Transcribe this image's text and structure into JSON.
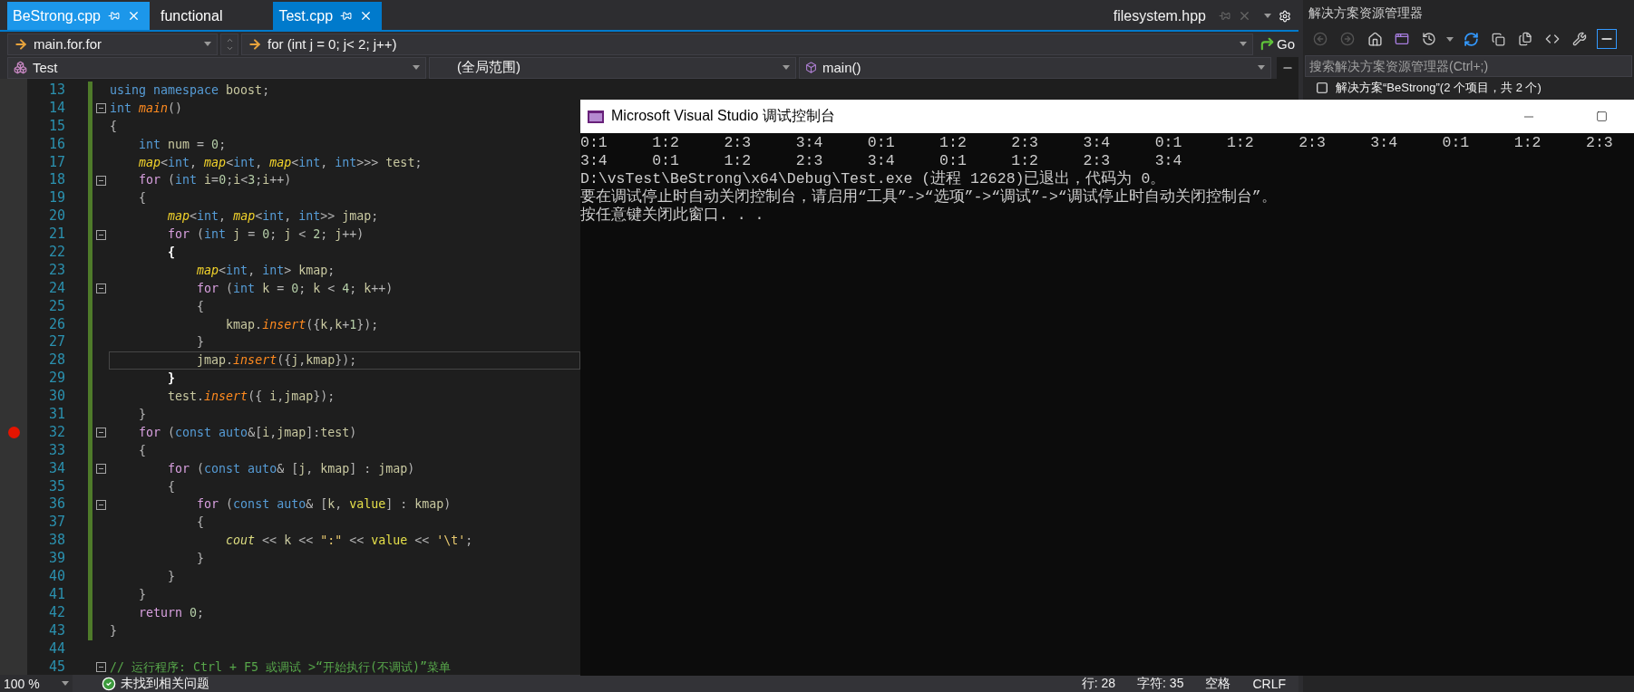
{
  "tabs": [
    {
      "label": "BeStrong.cpp",
      "selected": false,
      "highlighted": true,
      "closable": true
    },
    {
      "label": "functional",
      "selected": false,
      "highlighted": false,
      "closable": false
    },
    {
      "label": "Test.cpp",
      "selected": true,
      "highlighted": false,
      "closable": true
    }
  ],
  "overflow_tab": {
    "label": "filesystem.hpp"
  },
  "navigation": {
    "scope": "main.for.for",
    "member": "for (int j = 0; j< 2; j++)",
    "go": "Go"
  },
  "context": {
    "project": "Test",
    "scope": "(全局范围)",
    "function": "main()"
  },
  "lines": [
    {
      "number": "13",
      "changed": true,
      "fold": false,
      "breakpoint": false,
      "current": false,
      "tokens": [
        {
          "kind": "kw",
          "text": "using namespace "
        },
        {
          "kind": "var",
          "text": "boost"
        },
        {
          "kind": "punc",
          "text": ";"
        }
      ]
    },
    {
      "number": "14",
      "changed": true,
      "fold": true,
      "breakpoint": false,
      "current": false,
      "tokens": [
        {
          "kind": "kw",
          "text": "int "
        },
        {
          "kind": "fn",
          "text": "main"
        },
        {
          "kind": "punc",
          "text": "()"
        }
      ]
    },
    {
      "number": "15",
      "changed": true,
      "fold": false,
      "breakpoint": false,
      "current": false,
      "tokens": [
        {
          "kind": "punc",
          "text": "{"
        }
      ]
    },
    {
      "number": "16",
      "changed": true,
      "fold": false,
      "breakpoint": false,
      "current": false,
      "tokens": [
        {
          "kind": "kw",
          "text": "    int "
        },
        {
          "kind": "var",
          "text": "num"
        },
        {
          "kind": "punc",
          "text": " = "
        },
        {
          "kind": "num",
          "text": "0"
        },
        {
          "kind": "punc",
          "text": ";"
        }
      ]
    },
    {
      "number": "17",
      "changed": true,
      "fold": false,
      "breakpoint": false,
      "current": false,
      "tokens": [
        {
          "kind": "type",
          "text": "    map"
        },
        {
          "kind": "punc",
          "text": "<"
        },
        {
          "kind": "kw",
          "text": "int"
        },
        {
          "kind": "punc",
          "text": ", "
        },
        {
          "kind": "type",
          "text": "map"
        },
        {
          "kind": "punc",
          "text": "<"
        },
        {
          "kind": "kw",
          "text": "int"
        },
        {
          "kind": "punc",
          "text": ", "
        },
        {
          "kind": "type",
          "text": "map"
        },
        {
          "kind": "punc",
          "text": "<"
        },
        {
          "kind": "kw",
          "text": "int"
        },
        {
          "kind": "punc",
          "text": ", "
        },
        {
          "kind": "kw",
          "text": "int"
        },
        {
          "kind": "punc",
          "text": ">>> "
        },
        {
          "kind": "var",
          "text": "test"
        },
        {
          "kind": "punc",
          "text": ";"
        }
      ]
    },
    {
      "number": "18",
      "changed": true,
      "fold": true,
      "breakpoint": false,
      "current": false,
      "tokens": [
        {
          "kind": "ctrl",
          "text": "    for"
        },
        {
          "kind": "punc",
          "text": " ("
        },
        {
          "kind": "kw",
          "text": "int "
        },
        {
          "kind": "var",
          "text": "i"
        },
        {
          "kind": "punc",
          "text": "="
        },
        {
          "kind": "num",
          "text": "0"
        },
        {
          "kind": "punc",
          "text": ";"
        },
        {
          "kind": "var",
          "text": "i"
        },
        {
          "kind": "punc",
          "text": "<"
        },
        {
          "kind": "num",
          "text": "3"
        },
        {
          "kind": "punc",
          "text": ";"
        },
        {
          "kind": "var",
          "text": "i"
        },
        {
          "kind": "punc",
          "text": "++)"
        }
      ]
    },
    {
      "number": "19",
      "changed": true,
      "fold": false,
      "breakpoint": false,
      "current": false,
      "tokens": [
        {
          "kind": "punc",
          "text": "    {"
        }
      ]
    },
    {
      "number": "20",
      "changed": true,
      "fold": false,
      "breakpoint": false,
      "current": false,
      "tokens": [
        {
          "kind": "type",
          "text": "        map"
        },
        {
          "kind": "punc",
          "text": "<"
        },
        {
          "kind": "kw",
          "text": "int"
        },
        {
          "kind": "punc",
          "text": ", "
        },
        {
          "kind": "type",
          "text": "map"
        },
        {
          "kind": "punc",
          "text": "<"
        },
        {
          "kind": "kw",
          "text": "int"
        },
        {
          "kind": "punc",
          "text": ", "
        },
        {
          "kind": "kw",
          "text": "int"
        },
        {
          "kind": "punc",
          "text": ">> "
        },
        {
          "kind": "var",
          "text": "jmap"
        },
        {
          "kind": "punc",
          "text": ";"
        }
      ]
    },
    {
      "number": "21",
      "changed": true,
      "fold": true,
      "breakpoint": false,
      "current": false,
      "tokens": [
        {
          "kind": "ctrl",
          "text": "        for"
        },
        {
          "kind": "punc",
          "text": " ("
        },
        {
          "kind": "kw",
          "text": "int "
        },
        {
          "kind": "var",
          "text": "j"
        },
        {
          "kind": "punc",
          "text": " = "
        },
        {
          "kind": "num",
          "text": "0"
        },
        {
          "kind": "punc",
          "text": "; "
        },
        {
          "kind": "var",
          "text": "j"
        },
        {
          "kind": "punc",
          "text": " < "
        },
        {
          "kind": "num",
          "text": "2"
        },
        {
          "kind": "punc",
          "text": "; "
        },
        {
          "kind": "var",
          "text": "j"
        },
        {
          "kind": "punc",
          "text": "++)"
        }
      ]
    },
    {
      "number": "22",
      "changed": true,
      "fold": false,
      "breakpoint": false,
      "current": false,
      "tokens": [
        {
          "kind": "brace",
          "text": "        {"
        }
      ]
    },
    {
      "number": "23",
      "changed": true,
      "fold": false,
      "breakpoint": false,
      "current": false,
      "tokens": [
        {
          "kind": "type",
          "text": "            map"
        },
        {
          "kind": "punc",
          "text": "<"
        },
        {
          "kind": "kw",
          "text": "int"
        },
        {
          "kind": "punc",
          "text": ", "
        },
        {
          "kind": "kw",
          "text": "int"
        },
        {
          "kind": "punc",
          "text": "> "
        },
        {
          "kind": "var",
          "text": "kmap"
        },
        {
          "kind": "punc",
          "text": ";"
        }
      ]
    },
    {
      "number": "24",
      "changed": true,
      "fold": true,
      "breakpoint": false,
      "current": false,
      "tokens": [
        {
          "kind": "ctrl",
          "text": "            for"
        },
        {
          "kind": "punc",
          "text": " ("
        },
        {
          "kind": "kw",
          "text": "int "
        },
        {
          "kind": "var",
          "text": "k"
        },
        {
          "kind": "punc",
          "text": " = "
        },
        {
          "kind": "num",
          "text": "0"
        },
        {
          "kind": "punc",
          "text": "; "
        },
        {
          "kind": "var",
          "text": "k"
        },
        {
          "kind": "punc",
          "text": " < "
        },
        {
          "kind": "num",
          "text": "4"
        },
        {
          "kind": "punc",
          "text": "; "
        },
        {
          "kind": "var",
          "text": "k"
        },
        {
          "kind": "punc",
          "text": "++)"
        }
      ]
    },
    {
      "number": "25",
      "changed": true,
      "fold": false,
      "breakpoint": false,
      "current": false,
      "tokens": [
        {
          "kind": "punc",
          "text": "            {"
        }
      ]
    },
    {
      "number": "26",
      "changed": true,
      "fold": false,
      "breakpoint": false,
      "current": false,
      "tokens": [
        {
          "kind": "var",
          "text": "                kmap"
        },
        {
          "kind": "punc",
          "text": "."
        },
        {
          "kind": "fn",
          "text": "insert"
        },
        {
          "kind": "punc",
          "text": "({"
        },
        {
          "kind": "var",
          "text": "k"
        },
        {
          "kind": "punc",
          "text": ","
        },
        {
          "kind": "var",
          "text": "k"
        },
        {
          "kind": "punc",
          "text": "+"
        },
        {
          "kind": "num",
          "text": "1"
        },
        {
          "kind": "punc",
          "text": "});"
        }
      ]
    },
    {
      "number": "27",
      "changed": true,
      "fold": false,
      "breakpoint": false,
      "current": false,
      "tokens": [
        {
          "kind": "punc",
          "text": "            }"
        }
      ]
    },
    {
      "number": "28",
      "changed": true,
      "fold": false,
      "breakpoint": false,
      "current": true,
      "tokens": [
        {
          "kind": "var",
          "text": "            jmap"
        },
        {
          "kind": "punc",
          "text": "."
        },
        {
          "kind": "fn",
          "text": "insert"
        },
        {
          "kind": "punc",
          "text": "({"
        },
        {
          "kind": "var",
          "text": "j"
        },
        {
          "kind": "punc",
          "text": ","
        },
        {
          "kind": "var",
          "text": "kmap"
        },
        {
          "kind": "punc",
          "text": "});"
        }
      ]
    },
    {
      "number": "29",
      "changed": true,
      "fold": false,
      "breakpoint": false,
      "current": false,
      "tokens": [
        {
          "kind": "brace",
          "text": "        }"
        }
      ]
    },
    {
      "number": "30",
      "changed": true,
      "fold": false,
      "breakpoint": false,
      "current": false,
      "tokens": [
        {
          "kind": "var",
          "text": "        test"
        },
        {
          "kind": "punc",
          "text": "."
        },
        {
          "kind": "fn",
          "text": "insert"
        },
        {
          "kind": "punc",
          "text": "({ "
        },
        {
          "kind": "var",
          "text": "i"
        },
        {
          "kind": "punc",
          "text": ","
        },
        {
          "kind": "var",
          "text": "jmap"
        },
        {
          "kind": "punc",
          "text": "});"
        }
      ]
    },
    {
      "number": "31",
      "changed": true,
      "fold": false,
      "breakpoint": false,
      "current": false,
      "tokens": [
        {
          "kind": "punc",
          "text": "    }"
        }
      ]
    },
    {
      "number": "32",
      "changed": true,
      "fold": true,
      "breakpoint": true,
      "current": false,
      "tokens": [
        {
          "kind": "ctrl",
          "text": "    for"
        },
        {
          "kind": "punc",
          "text": " ("
        },
        {
          "kind": "kw",
          "text": "const auto"
        },
        {
          "kind": "punc",
          "text": "&["
        },
        {
          "kind": "var",
          "text": "i"
        },
        {
          "kind": "punc",
          "text": ","
        },
        {
          "kind": "var",
          "text": "jmap"
        },
        {
          "kind": "punc",
          "text": "]:"
        },
        {
          "kind": "var",
          "text": "test"
        },
        {
          "kind": "punc",
          "text": ")"
        }
      ]
    },
    {
      "number": "33",
      "changed": true,
      "fold": false,
      "breakpoint": false,
      "current": false,
      "tokens": [
        {
          "kind": "punc",
          "text": "    {"
        }
      ]
    },
    {
      "number": "34",
      "changed": true,
      "fold": true,
      "breakpoint": false,
      "current": false,
      "tokens": [
        {
          "kind": "ctrl",
          "text": "        for"
        },
        {
          "kind": "punc",
          "text": " ("
        },
        {
          "kind": "kw",
          "text": "const auto"
        },
        {
          "kind": "punc",
          "text": "& ["
        },
        {
          "kind": "var",
          "text": "j"
        },
        {
          "kind": "punc",
          "text": ", "
        },
        {
          "kind": "var",
          "text": "kmap"
        },
        {
          "kind": "punc",
          "text": "] : "
        },
        {
          "kind": "var",
          "text": "jmap"
        },
        {
          "kind": "punc",
          "text": ")"
        }
      ]
    },
    {
      "number": "35",
      "changed": true,
      "fold": false,
      "breakpoint": false,
      "current": false,
      "tokens": [
        {
          "kind": "punc",
          "text": "        {"
        }
      ]
    },
    {
      "number": "36",
      "changed": true,
      "fold": true,
      "breakpoint": false,
      "current": false,
      "tokens": [
        {
          "kind": "ctrl",
          "text": "            for"
        },
        {
          "kind": "punc",
          "text": " ("
        },
        {
          "kind": "kw",
          "text": "const auto"
        },
        {
          "kind": "punc",
          "text": "& ["
        },
        {
          "kind": "var",
          "text": "k"
        },
        {
          "kind": "punc",
          "text": ", "
        },
        {
          "kind": "fld",
          "text": "value"
        },
        {
          "kind": "punc",
          "text": "] : "
        },
        {
          "kind": "var",
          "text": "kmap"
        },
        {
          "kind": "punc",
          "text": ")"
        }
      ]
    },
    {
      "number": "37",
      "changed": true,
      "fold": false,
      "breakpoint": false,
      "current": false,
      "tokens": [
        {
          "kind": "punc",
          "text": "            {"
        }
      ]
    },
    {
      "number": "38",
      "changed": true,
      "fold": false,
      "breakpoint": false,
      "current": false,
      "tokens": [
        {
          "kind": "glob",
          "text": "                cout"
        },
        {
          "kind": "punc",
          "text": " << "
        },
        {
          "kind": "var",
          "text": "k"
        },
        {
          "kind": "punc",
          "text": " << "
        },
        {
          "kind": "str",
          "text": "\":\""
        },
        {
          "kind": "punc",
          "text": " << "
        },
        {
          "kind": "fld",
          "text": "value"
        },
        {
          "kind": "punc",
          "text": " << "
        },
        {
          "kind": "str",
          "text": "'\\t'"
        },
        {
          "kind": "punc",
          "text": ";"
        }
      ]
    },
    {
      "number": "39",
      "changed": true,
      "fold": false,
      "breakpoint": false,
      "current": false,
      "tokens": [
        {
          "kind": "punc",
          "text": "            }"
        }
      ]
    },
    {
      "number": "40",
      "changed": true,
      "fold": false,
      "breakpoint": false,
      "current": false,
      "tokens": [
        {
          "kind": "punc",
          "text": "        }"
        }
      ]
    },
    {
      "number": "41",
      "changed": true,
      "fold": false,
      "breakpoint": false,
      "current": false,
      "tokens": [
        {
          "kind": "punc",
          "text": "    }"
        }
      ]
    },
    {
      "number": "42",
      "changed": true,
      "fold": false,
      "breakpoint": false,
      "current": false,
      "tokens": [
        {
          "kind": "ctrl",
          "text": "    return "
        },
        {
          "kind": "num",
          "text": "0"
        },
        {
          "kind": "punc",
          "text": ";"
        }
      ]
    },
    {
      "number": "43",
      "changed": true,
      "fold": false,
      "breakpoint": false,
      "current": false,
      "tokens": [
        {
          "kind": "punc",
          "text": "}"
        }
      ]
    },
    {
      "number": "44",
      "changed": false,
      "fold": false,
      "breakpoint": false,
      "current": false
    },
    {
      "number": "45",
      "changed": false,
      "fold": true,
      "breakpoint": false,
      "current": false,
      "tokens": [
        {
          "kind": "cmt",
          "text": "// 运行程序: Ctrl + F5 或调试 >“开始执行(不调试)”菜单"
        }
      ]
    }
  ],
  "status": {
    "zoom": "100 %",
    "issues": "未找到相关问题",
    "line": "行: 28",
    "column": "字符: 35",
    "indent": "空格",
    "eol": "CRLF"
  },
  "explorer": {
    "title": "解决方案资源管理器",
    "back_enabled": false,
    "forward_enabled": false,
    "preview_on": true,
    "search": {
      "placeholder": "搜索解决方案资源管理器(Ctrl+;)"
    },
    "tree_item": "解决方案“BeStrong”(2 个项目，共 2 个)"
  },
  "console": {
    "title": "Microsoft Visual Studio 调试控制台",
    "lines": [
      "0:1\t1:2\t2:3\t3:4\t0:1\t1:2\t2:3\t3:4\t0:1\t1:2\t2:3\t3:4\t0:1\t1:2\t2:3",
      "3:4\t0:1\t1:2\t2:3\t3:4\t0:1\t1:2\t2:3\t3:4",
      "D:\\vsTest\\BeStrong\\x64\\Debug\\Test.exe (进程 12628)已退出，代码为 0。",
      "要在调试停止时自动关闭控制台，请启用“工具”->“选项”->“调试”->“调试停止时自动关闭控制台”。",
      "按任意键关闭此窗口. . ."
    ]
  }
}
